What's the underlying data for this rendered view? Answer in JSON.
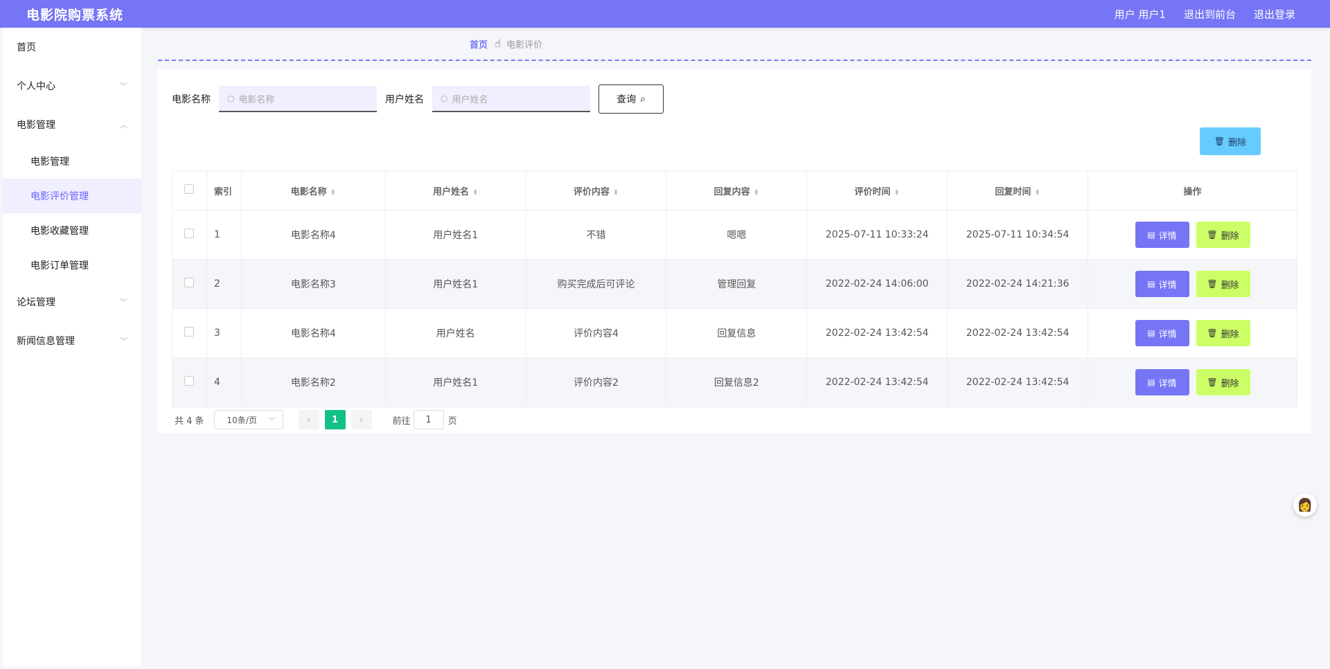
{
  "header": {
    "title": "电影院购票系统",
    "nav": [
      "用户 用户1",
      "退出到前台",
      "退出登录"
    ]
  },
  "sidebar": {
    "items": [
      {
        "label": "首页"
      },
      {
        "label": "个人中心"
      },
      {
        "label": "电影管理"
      },
      {
        "label": "电影管理"
      },
      {
        "label": "电影评价管理"
      },
      {
        "label": "电影收藏管理"
      },
      {
        "label": "电影订单管理"
      },
      {
        "label": "论坛管理"
      },
      {
        "label": "新闻信息管理"
      }
    ]
  },
  "breadcrumb": {
    "home": "首页",
    "current": "电影评价"
  },
  "search": {
    "movie_label": "电影名称",
    "movie_placeholder": "电影名称",
    "user_label": "用户姓名",
    "user_placeholder": "用户姓名",
    "query_label": "查询"
  },
  "toolbar": {
    "delete_label": "删除"
  },
  "table": {
    "headers": [
      "索引",
      "电影名称",
      "用户姓名",
      "评价内容",
      "回复内容",
      "评价时间",
      "回复时间",
      "操作"
    ],
    "rows": [
      {
        "index": "1",
        "movie": "电影名称4",
        "user": "用户姓名1",
        "review": "不错",
        "reply": "嗯嗯",
        "review_time": "2025-07-11 10:33:24",
        "reply_time": "2025-07-11 10:34:54"
      },
      {
        "index": "2",
        "movie": "电影名称3",
        "user": "用户姓名1",
        "review": "购买完成后可评论",
        "reply": "管理回复",
        "review_time": "2022-02-24 14:06:00",
        "reply_time": "2022-02-24 14:21:36"
      },
      {
        "index": "3",
        "movie": "电影名称4",
        "user": "用户姓名",
        "review": "评价内容4",
        "reply": "回复信息",
        "review_time": "2022-02-24 13:42:54",
        "reply_time": "2022-02-24 13:42:54"
      },
      {
        "index": "4",
        "movie": "电影名称2",
        "user": "用户姓名1",
        "review": "评价内容2",
        "reply": "回复信息2",
        "review_time": "2022-02-24 13:42:54",
        "reply_time": "2022-02-24 13:42:54"
      }
    ],
    "detail_label": "详情",
    "delete_label": "删除"
  },
  "pagination": {
    "total": "共 4 条",
    "page_size": "10条/页",
    "current": "1",
    "goto_prefix": "前往",
    "goto_value": "1",
    "goto_suffix": "页"
  },
  "colors": {
    "accent": "#7575f5",
    "active_page": "#13c08a",
    "delete_top": "#66ccff",
    "delete_row": "#ccff66"
  }
}
